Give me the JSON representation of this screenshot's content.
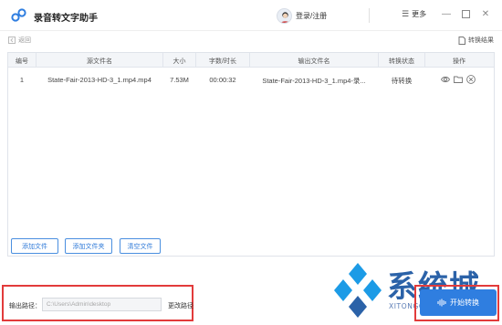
{
  "app": {
    "title": "录音转文字助手",
    "login_label": "登录/注册",
    "more_label": "更多"
  },
  "toolbar": {
    "back_label": "返回",
    "results_label": "转换结果"
  },
  "table": {
    "headers": [
      "编号",
      "源文件名",
      "大小",
      "字数/时长",
      "输出文件名",
      "转换状态",
      "操作"
    ],
    "rows": [
      {
        "index": "1",
        "source_name": "State-Fair-2013-HD-3_1.mp4.mp4",
        "size": "7.53M",
        "duration": "00:00:32",
        "output_name": "State-Fair-2013-HD-3_1.mp4-录...",
        "status": "待转换"
      }
    ]
  },
  "buttons": {
    "add_file": "添加文件",
    "add_folder": "添加文件夹",
    "clear_files": "清空文件",
    "start": "开始转换"
  },
  "output": {
    "label": "输出路径：",
    "path": "C:\\Users\\Admin\\desktop",
    "change_label": "更改路径"
  },
  "watermark": {
    "text": "系统城",
    "url": "XITONGCHENG.COM"
  },
  "colors": {
    "accent": "#2f7ee0",
    "highlight_red": "#e23b3b",
    "watermark_blue": "#2b62a8"
  }
}
